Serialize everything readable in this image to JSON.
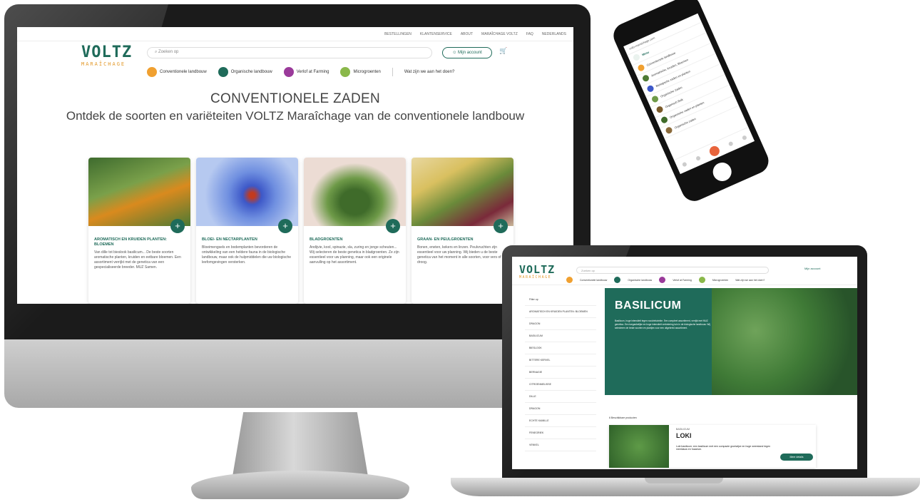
{
  "desktop": {
    "topbar_links": [
      "BESTELLINGEN",
      "KLANTENSERVICE",
      "ABOUT",
      "MARAÎCHAGE VOLTZ",
      "FAQ",
      "NEDERLANDS"
    ],
    "logo": {
      "main": "VOLTZ",
      "sub": "MARAÎCHAGE"
    },
    "search_placeholder": "Zoeken op",
    "account_label": "Mijn account",
    "categories": [
      {
        "label": "Conventionele landbouw",
        "color": "#f0a030"
      },
      {
        "label": "Organische landbouw",
        "color": "#1f6b5a"
      },
      {
        "label": "Verlof at Farming",
        "color": "#9a3a9a"
      },
      {
        "label": "Microgroenten",
        "color": "#8ab84a"
      }
    ],
    "extra_link": "Wat zijn we aan het doen?",
    "hero_title": "CONVENTIONELE ZADEN",
    "hero_subtitle": "Ontdek de soorten en variëteiten VOLTZ Maraîchage van de conventionele landbouw",
    "cards": [
      {
        "title": "AROMATISCH EN KRUIDEN PLANTEN: BLOEMEN",
        "text": "Van dille tot bieslook basilicum... De beste soorten aromatische planten, kruiden en eetbare bloemen. Een assortiment verrijkt met de genetica van een gespecialiseerde breeder. MUZ Samen."
      },
      {
        "title": "BLOEI- EN NECTARPLANTEN",
        "text": "Bloeimengsels en bodemplanten bevorderen de ontwikkeling van een heldere fauna in de biologische landbouw, maar ook de hulpmiddelen die uw biologische leefomgevingen versterken."
      },
      {
        "title": "BLADGROENTEN",
        "text": "Andijvie, kool, spinazie, sla, zuring en jonge scheuten... Wij selecteren de beste genetica in bladgroenten. Ze zijn essentieel voor uw planning, maar ook een originele aanvulling op het assortiment."
      },
      {
        "title": "GRAAN- EN PEULGROENTEN",
        "text": "Bonen, erwten, kekers en linzen. Peulvruchten zijn essentieel voor uw planning. Wij bieden u de beste genetica van het moment in alle soorten, voor vers of droog."
      }
    ]
  },
  "phone": {
    "url": "voltz-maraichage.com",
    "menu_items": [
      "Menu",
      "Conventionele landbouw",
      "Aromatische, Kruiden, Bloemen",
      "Biologische zaden en planten",
      "Organische Zaden",
      "Organisch Bulk",
      "Organische zaden en planten",
      "Organische zaden"
    ]
  },
  "laptop": {
    "logo": {
      "main": "VOLTZ",
      "sub": "MARAÎCHAGE"
    },
    "search_placeholder": "Zoeken op",
    "account_label": "Mijn account",
    "categories": [
      "Conventionele landbouw",
      "Organische landbouw",
      "Verlof at Farming",
      "Microgroenten",
      "Wat zijn we aan het doen?"
    ],
    "sidebar_items": [
      "Filter op",
      "AROMATISCH EN KRUIDEN PLANTEN: BLOEMEN",
      "DRAGON",
      "BASILICUM",
      "BIESLOOK",
      "BITTERE KERVEL",
      "BERNAGIE",
      "CITROENMELISSE",
      "DILLE",
      "DRAGON",
      "ECHTE KAMILLE",
      "FENEGRIEK",
      "VENKEL"
    ],
    "banner_title": "BASILICUM",
    "banner_text": "Basilicum, hoge intensiteit tegen roodvlekziekte. Een compleet assortiment, verrijkt met MUZ genetica. Een toegankelijke en hoge intensiteit verbetering tuin in de biologische landbouw. Wij selecteren de beste soorten en plantjes voor een uitgebreid assortiment.",
    "results_text": "6 Beschikbare producten",
    "product": {
      "type": "BASILICUM",
      "name": "LOKI",
      "desc": "Loki basilicum: een basilicum met een compacte groeiwijze en hoge weerstand tegen meeldauw en fusarium.",
      "button": "Meer details"
    }
  }
}
